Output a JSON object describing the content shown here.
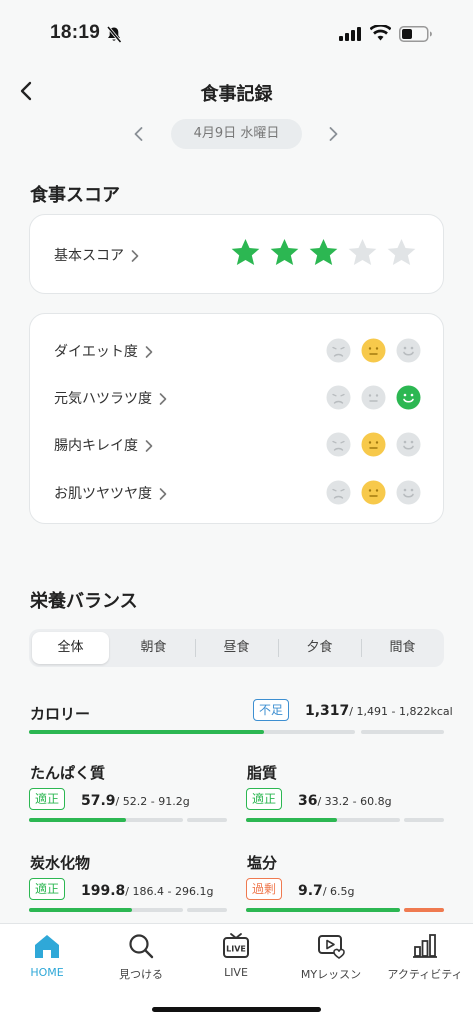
{
  "status": {
    "time": "18:19"
  },
  "nav": {
    "title": "食事記録"
  },
  "date": {
    "label": "4月9日 水曜日"
  },
  "score": {
    "section_title": "食事スコア",
    "basic_label": "基本スコア",
    "stars": 3,
    "stars_max": 5,
    "items": [
      {
        "label": "ダイエット度",
        "selected": "neutral"
      },
      {
        "label": "元気ハツラツ度",
        "selected": "happy"
      },
      {
        "label": "腸内キレイ度",
        "selected": "neutral"
      },
      {
        "label": "お肌ツヤツヤ度",
        "selected": "neutral"
      }
    ]
  },
  "nutrition": {
    "section_title": "栄養バランス",
    "tabs": [
      "全体",
      "朝食",
      "昼食",
      "夕食",
      "間食"
    ],
    "active_tab": 0,
    "calorie": {
      "label": "カロリー",
      "badge": "不足",
      "value": "1,317",
      "range": "/ 1,491 - 1,822kcal",
      "fill": 0.72
    },
    "items": [
      {
        "label": "たんぱく質",
        "badge": "適正",
        "status": "ok",
        "value": "57.9",
        "range": "/ 52.2 - 91.2g",
        "fill": 0.63
      },
      {
        "label": "脂質",
        "badge": "適正",
        "status": "ok",
        "value": "36",
        "range": "/ 33.2 - 60.8g",
        "fill": 0.59
      },
      {
        "label": "炭水化物",
        "badge": "適正",
        "status": "ok",
        "value": "199.8",
        "range": "/ 186.4 - 296.1g",
        "fill": 0.67
      },
      {
        "label": "塩分",
        "badge": "過剰",
        "status": "over",
        "value": "9.7",
        "range": "/ 6.5g",
        "fill": 1.0
      }
    ]
  },
  "tabbar": {
    "items": [
      {
        "label": "HOME",
        "icon": "home-icon",
        "active": true
      },
      {
        "label": "見つける",
        "icon": "search-icon",
        "active": false
      },
      {
        "label": "LIVE",
        "icon": "live-tv-icon",
        "active": false
      },
      {
        "label": "MYレッスン",
        "icon": "video-heart-icon",
        "active": false
      },
      {
        "label": "アクティビティ",
        "icon": "bar-chart-icon",
        "active": false
      }
    ]
  },
  "colors": {
    "green": "#2cb752",
    "yellow": "#f7c94b",
    "blue": "#3d8fd1",
    "orange": "#ef7a50",
    "accent": "#2fa8d8",
    "inactive": "#dcdfe1"
  }
}
